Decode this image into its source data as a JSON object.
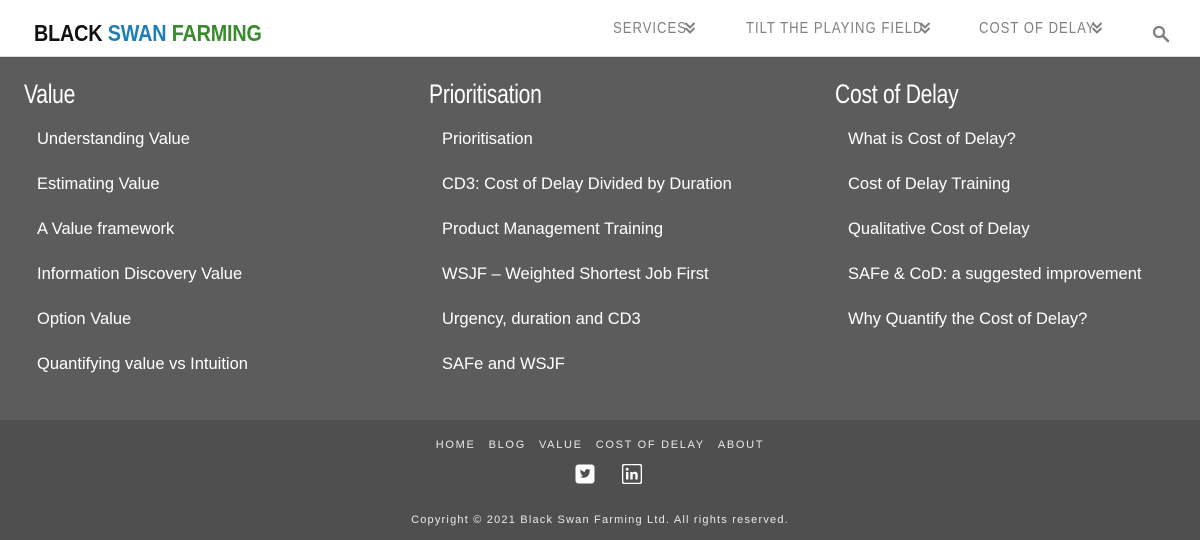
{
  "logo": {
    "word1": "BLACK",
    "word2": "SWAN",
    "word3": "FARMING"
  },
  "nav": {
    "items": [
      {
        "label": "SERVICES",
        "icon": "chevron-double-down-icon"
      },
      {
        "label": "TILT THE PLAYING FIELD",
        "icon": "chevron-double-down-icon"
      },
      {
        "label": "COST OF DELAY",
        "icon": "chevron-double-down-icon"
      }
    ],
    "search_icon": "search-icon"
  },
  "menu": {
    "columns": [
      {
        "title": "Value",
        "links": [
          "Understanding Value",
          "Estimating Value",
          "A Value framework",
          "Information Discovery Value",
          "Option Value",
          "Quantifying value vs Intuition"
        ]
      },
      {
        "title": "Prioritisation",
        "links": [
          "Prioritisation",
          "CD3: Cost of Delay Divided by Duration",
          "Product Management Training",
          "WSJF – Weighted Shortest Job First",
          "Urgency, duration and CD3",
          "SAFe and WSJF"
        ]
      },
      {
        "title": "Cost of Delay",
        "links": [
          "What is Cost of Delay?",
          "Cost of Delay Training",
          "Qualitative Cost of Delay",
          "SAFe & CoD: a suggested improvement",
          "Why Quantify the Cost of Delay?"
        ]
      }
    ]
  },
  "footer": {
    "links": [
      "HOME",
      "BLOG",
      "VALUE",
      "COST OF DELAY",
      "ABOUT"
    ],
    "social": [
      "twitter-icon",
      "linkedin-icon"
    ],
    "copyright": "Copyright © 2021 Black Swan Farming Ltd. All rights reserved."
  },
  "colors": {
    "header_bg": "#ffffff",
    "menu_bg": "#5c5c5c",
    "footer_bg": "#4f4f4f",
    "logo_black": "#111111",
    "logo_blue": "#1f7fb5",
    "logo_green": "#3a8a2e",
    "nav_text": "#808080"
  }
}
